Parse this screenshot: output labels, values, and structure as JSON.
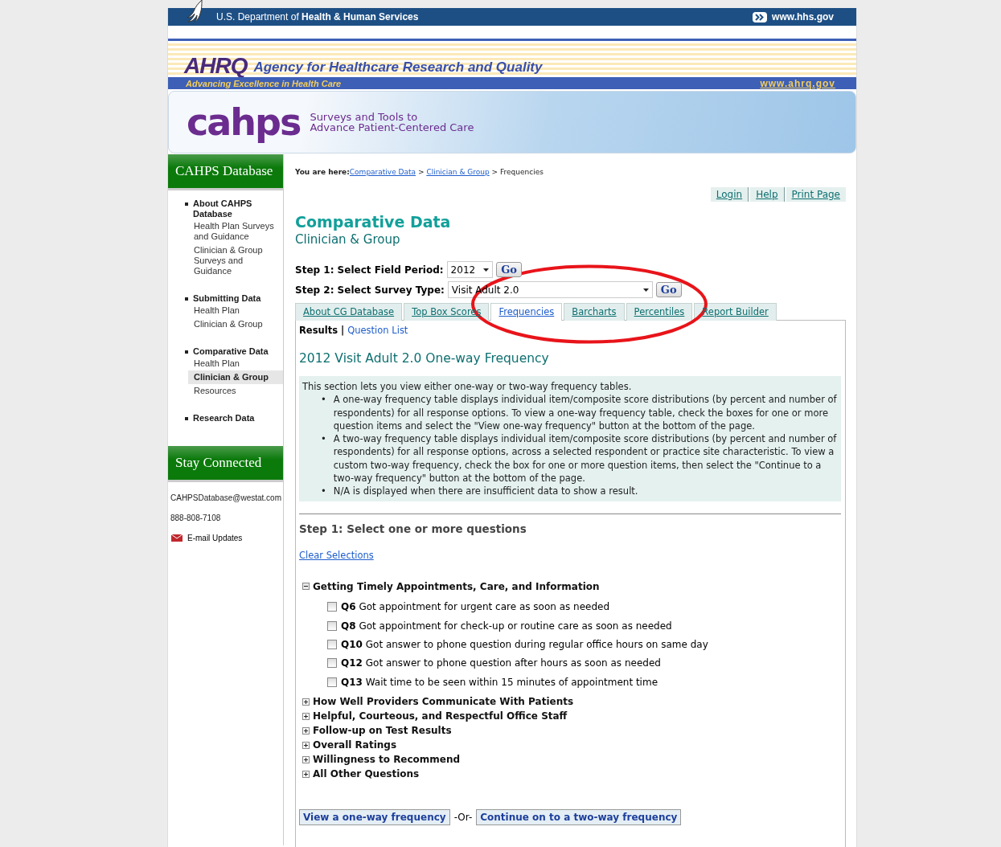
{
  "header": {
    "hhs_text": "U.S. Department of **Health & Human Services**",
    "hhs_link": "www.hhs.gov",
    "ahrq_logo": "AHRQ",
    "ahrq_name": "Agency for Healthcare Research and Quality",
    "ahrq_tagline": "Advancing Excellence in Health Care",
    "ahrq_link": "www.ahrq.gov",
    "cahps_logo": "cahps",
    "cahps_tagline": [
      "Surveys and Tools to",
      "Advance Patient-Centered Care"
    ]
  },
  "sidebar": {
    "title": "CAHPS Database",
    "sections": [
      {
        "label": "About CAHPS Database",
        "items": [
          {
            "label": "Health Plan Surveys and Guidance",
            "selected": false
          },
          {
            "label": "Clinician & Group Surveys and Guidance",
            "selected": false
          }
        ]
      },
      {
        "label": "Submitting Data",
        "items": [
          {
            "label": "Health Plan",
            "selected": false
          },
          {
            "label": "Clinician & Group",
            "selected": false
          }
        ]
      },
      {
        "label": "Comparative Data",
        "items": [
          {
            "label": "Health Plan",
            "selected": false
          },
          {
            "label": "Clinician & Group",
            "selected": true
          },
          {
            "label": "Resources",
            "selected": false
          }
        ]
      },
      {
        "label": "Research Data"
      }
    ],
    "stay_title": "Stay Connected",
    "email": "CAHPSDatabase@westat.com",
    "phone": "888-808-7108",
    "updates": "E-mail Updates"
  },
  "breadcrumb": {
    "label": "You are here:",
    "links": [
      "Comparative Data",
      "Clinician & Group"
    ],
    "separator": ">",
    "current": "Frequencies"
  },
  "top_links": [
    "Login",
    "Help",
    "Print Page"
  ],
  "heading": "Comparative Data",
  "subheading": "Clinician & Group",
  "step1": {
    "label": "Step 1: Select Field Period:",
    "value": "2012",
    "button": "Go"
  },
  "step2": {
    "label": "Step 2: Select Survey Type:",
    "value": "Visit Adult 2.0",
    "button": "Go"
  },
  "tabs": [
    {
      "label": "About CG Database",
      "selected": false
    },
    {
      "label": "Top Box Scores",
      "selected": false
    },
    {
      "label": "Frequencies",
      "selected": true
    },
    {
      "label": "Barcharts",
      "selected": false
    },
    {
      "label": "Percentiles",
      "selected": false
    },
    {
      "label": "Report Builder",
      "selected": false
    }
  ],
  "subnav": {
    "current": "Results",
    "separator": "|",
    "link": "Question List"
  },
  "results_title": "2012 Visit Adult 2.0 One-way Frequency",
  "info": {
    "bullet": "•",
    "intro": "This section lets you view either one-way or two-way frequency tables.",
    "bullets": [
      "A one-way frequency table displays individual item/composite score distributions (by percent and number of respondents) for all response options. To view a one-way frequency table, check the boxes for one or more question items and select the \"View one-way frequency\" button at the bottom of the page.",
      "A two-way frequency table displays individual item/composite score distributions (by percent and number of respondents) for all response options, across a selected respondent or practice site characteristic. To view a custom two-way frequency, check the box for one or more question items, then select the \"Continue to a two-way frequency\" button at the bottom of the page.",
      "N/A is displayed when there are insufficient data to show a result."
    ]
  },
  "step_heading": "Step 1: Select one or more questions",
  "clear_link": "Clear Selections",
  "groups": [
    {
      "label": "Getting Timely Appointments, Care, and Information",
      "expanded": true,
      "questions": [
        {
          "id": "Q6",
          "text": "Got appointment for urgent care as soon as needed",
          "checked": false
        },
        {
          "id": "Q8",
          "text": "Got appointment for check-up or routine care as soon as needed",
          "checked": false
        },
        {
          "id": "Q10",
          "text": "Got answer to phone question during regular office hours on same day",
          "checked": false
        },
        {
          "id": "Q12",
          "text": "Got answer to phone question after hours as soon as needed",
          "checked": false
        },
        {
          "id": "Q13",
          "text": "Wait time to be seen within 15 minutes of appointment time",
          "checked": false
        }
      ]
    },
    {
      "label": "How Well Providers Communicate With Patients",
      "expanded": false
    },
    {
      "label": "Helpful, Courteous, and Respectful Office Staff",
      "expanded": false
    },
    {
      "label": "Follow-up on Test Results",
      "expanded": false
    },
    {
      "label": "Overall Ratings",
      "expanded": false
    },
    {
      "label": "Willingness to Recommend",
      "expanded": false
    },
    {
      "label": "All Other Questions",
      "expanded": false
    }
  ],
  "buttons": {
    "one_way": "View a one-way frequency",
    "or": "-Or-",
    "two_way": "Continue on to a two-way frequency"
  }
}
